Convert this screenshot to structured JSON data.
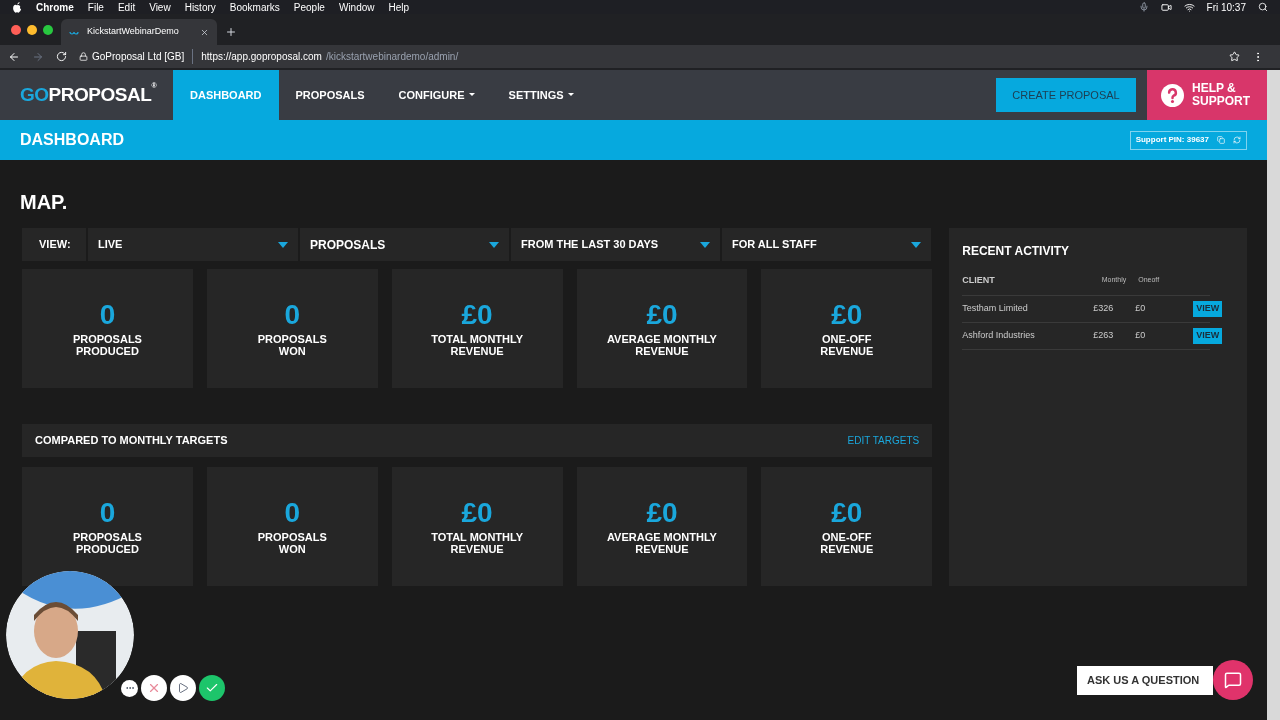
{
  "menubar": {
    "items": [
      "Chrome",
      "File",
      "Edit",
      "View",
      "History",
      "Bookmarks",
      "People",
      "Window",
      "Help"
    ],
    "clock": "Fri 10:37"
  },
  "browser": {
    "tab_title": "KickstartWebinarDemo",
    "site_identity": "GoProposal Ltd [GB]",
    "url_host": "https://app.goproposal.com",
    "url_path": "/kickstartwebinardemo/admin/"
  },
  "nav": {
    "logo_accent": "GO",
    "logo_main": "PROPOSAL",
    "logo_mark": "®",
    "items": [
      {
        "label": "DASHBOARD",
        "selected": true,
        "dropdown": false
      },
      {
        "label": "PROPOSALS",
        "selected": false,
        "dropdown": false
      },
      {
        "label": "CONFIGURE",
        "selected": false,
        "dropdown": true
      },
      {
        "label": "SETTINGS",
        "selected": false,
        "dropdown": true
      }
    ],
    "create_button": "CREATE PROPOSAL",
    "help_button": "HELP & SUPPORT"
  },
  "page_header": {
    "title": "DASHBOARD",
    "support_pin": "Support PIN: 39637"
  },
  "map": {
    "title": "MAP.",
    "view_label": "VIEW:",
    "filters": [
      "LIVE",
      "PROPOSALS",
      "FROM THE LAST 30 DAYS",
      "FOR ALL STAFF"
    ],
    "stats": [
      {
        "value": "0",
        "label_lines": [
          "PROPOSALS",
          "PRODUCED"
        ]
      },
      {
        "value": "0",
        "label_lines": [
          "PROPOSALS",
          "WON"
        ]
      },
      {
        "value": "£0",
        "label_lines": [
          "TOTAL MONTHLY",
          "REVENUE"
        ]
      },
      {
        "value": "£0",
        "label_lines": [
          "AVERAGE MONTHLY",
          "REVENUE"
        ]
      },
      {
        "value": "£0",
        "label_lines": [
          "ONE-OFF",
          "REVENUE"
        ]
      }
    ]
  },
  "targets": {
    "title": "COMPARED TO MONTHLY TARGETS",
    "edit_link": "EDIT TARGETS",
    "stats": [
      {
        "value": "0",
        "label_lines": [
          "PROPOSALS",
          "PRODUCED"
        ]
      },
      {
        "value": "0",
        "label_lines": [
          "PROPOSALS",
          "WON"
        ]
      },
      {
        "value": "£0",
        "label_lines": [
          "TOTAL MONTHLY",
          "REVENUE"
        ]
      },
      {
        "value": "£0",
        "label_lines": [
          "AVERAGE MONTHLY",
          "REVENUE"
        ]
      },
      {
        "value": "£0",
        "label_lines": [
          "ONE-OFF",
          "REVENUE"
        ]
      }
    ]
  },
  "recent_activity": {
    "title": "RECENT ACTIVITY",
    "columns": [
      "CLIENT",
      "Monthly",
      "Oneoff"
    ],
    "rows": [
      {
        "client": "Testham Limited",
        "monthly": "£326",
        "oneoff": "£0",
        "action": "VIEW"
      },
      {
        "client": "Ashford Industries",
        "monthly": "£263",
        "oneoff": "£0",
        "action": "VIEW"
      }
    ]
  },
  "chat_button": "ASK US A QUESTION"
}
